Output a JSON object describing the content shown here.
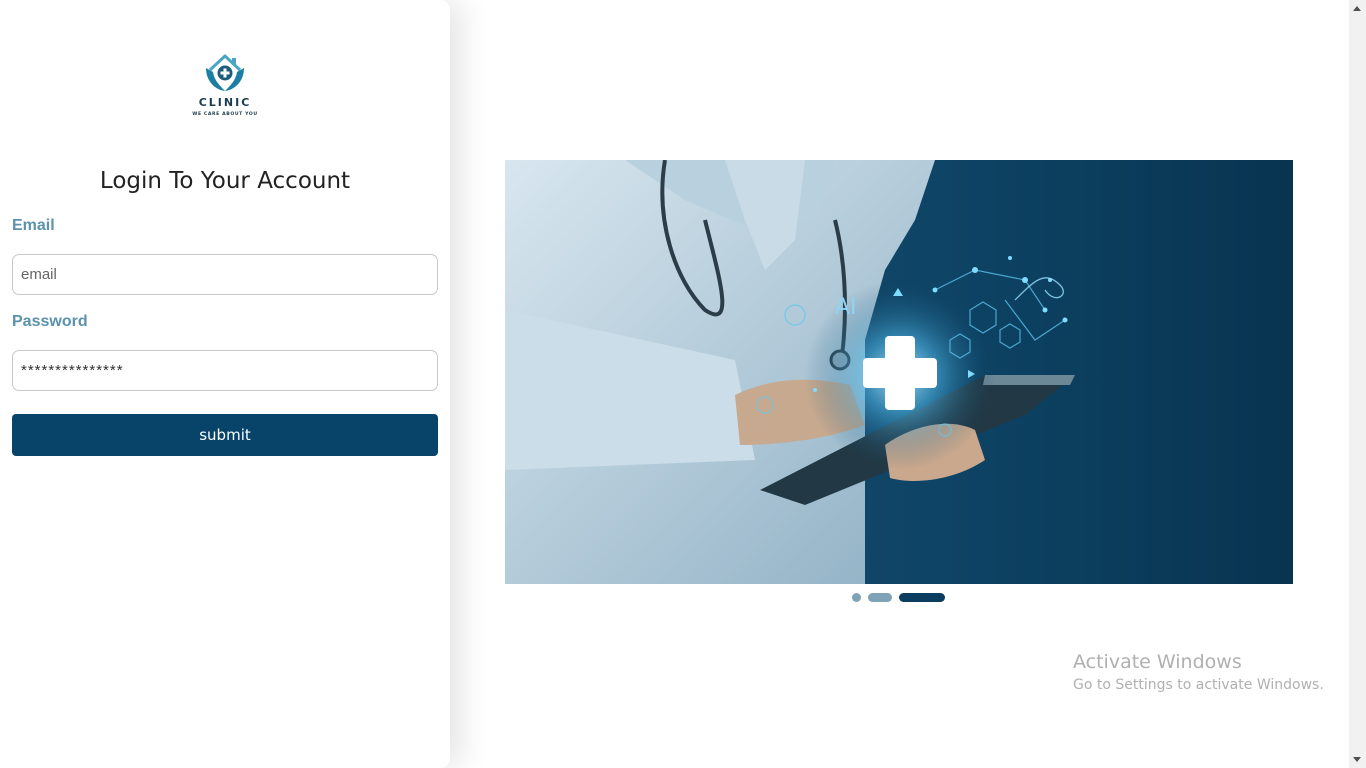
{
  "logo": {
    "name": "CLINIC",
    "tagline": "WE CARE ABOUT YOU",
    "icon": "house-hands-cross-icon",
    "colors": {
      "teal": "#2f8fb0",
      "dark": "#1c3b4d"
    }
  },
  "login": {
    "title": "Login To Your Account",
    "email_label": "Email",
    "email_placeholder": "email",
    "password_label": "Password",
    "password_value": "***************",
    "submit_label": "submit"
  },
  "hero": {
    "overlay_text": "AI",
    "icon": "medical-cross-icon"
  },
  "carousel": {
    "slide_count": 3,
    "active_slide": 3
  },
  "watermark": {
    "title": "Activate Windows",
    "subtitle": "Go to Settings to activate Windows."
  },
  "colors": {
    "accent": "#08436a",
    "label": "#5b93ac"
  }
}
